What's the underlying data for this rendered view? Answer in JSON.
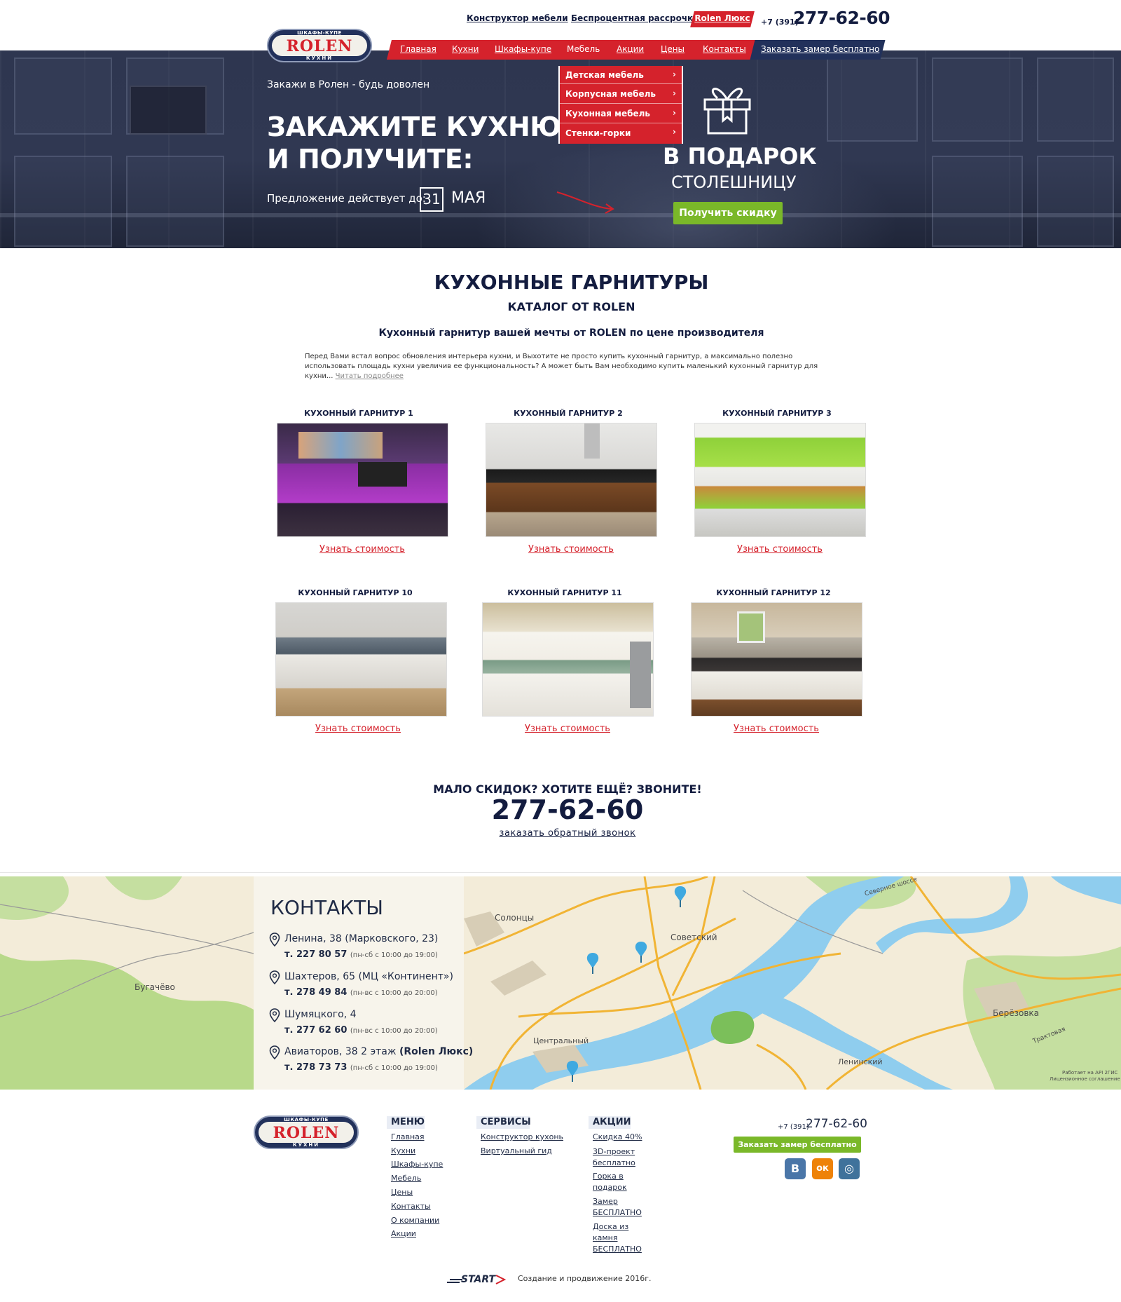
{
  "colors": {
    "brand_red": "#d5222c",
    "navy": "#131c3f",
    "green": "#7ab829"
  },
  "header": {
    "top_links": [
      "Конструктор мебели",
      "Беспроцентная рассрочка"
    ],
    "luxe_label": "Rolen Люкс",
    "phone_prefix": "+7 (391)",
    "phone": "277-62-60"
  },
  "logo": {
    "top_text": "ШКАФЫ-КУПЕ",
    "word": "ROLEN",
    "bottom_text": "КУХНИ"
  },
  "nav": {
    "items": [
      "Главная",
      "Кухни",
      "Шкафы-купе",
      "Мебель",
      "Акции",
      "Цены",
      "Контакты"
    ],
    "cta": "Заказать замер бесплатно",
    "dropdown": [
      "Детская мебель",
      "Корпусная мебель",
      "Кухонная мебель",
      "Стенки-горки"
    ]
  },
  "hero": {
    "tagline": "Закажи в Ролен - будь доволен",
    "headline_1": "ЗАКАЖИТЕ КУХНЮ",
    "headline_2": "И ПОЛУЧИТЕ:",
    "offer_label": "Предложение действует до:",
    "day": "31",
    "month": "МАЯ",
    "gift_title": "В ПОДАРОК",
    "gift_sub": "СТОЛЕШНИЦУ",
    "button": "Получить скидку"
  },
  "catalog": {
    "title": "КУХОННЫЕ ГАРНИТУРЫ",
    "subtitle": "КАТАЛОГ ОТ ROLEN",
    "tagline": "Кухонный гарнитур вашей мечты от ROLEN по цене производителя",
    "intro": "Перед Вами встал вопрос обновления интерьера кухни, и Выхотите не просто купить кухонный гарнитур, а максимально полезно использовать площадь кухни увеличив ее функциональность? А может быть Вам необходимо купить маленький кухонный гарнитур для кухни...",
    "read_more": "Читать подробнее",
    "cards": [
      {
        "title": "КУХОННЫЙ ГАРНИТУР 1",
        "link": "Узнать стоимость"
      },
      {
        "title": "КУХОННЫЙ ГАРНИТУР 2",
        "link": "Узнать стоимость"
      },
      {
        "title": "КУХОННЫЙ ГАРНИТУР 3",
        "link": "Узнать стоимость"
      },
      {
        "title": "КУХОННЫЙ ГАРНИТУР 10",
        "link": "Узнать стоимость"
      },
      {
        "title": "КУХОННЫЙ ГАРНИТУР 11",
        "link": "Узнать стоимость"
      },
      {
        "title": "КУХОННЫЙ ГАРНИТУР 12",
        "link": "Узнать стоимость"
      }
    ]
  },
  "cta": {
    "question": "МАЛО СКИДОК? ХОТИТЕ ЕЩЁ? ЗВОНИТЕ!",
    "phone": "277-62-60",
    "callback": "заказать обратный звонок"
  },
  "contacts": {
    "title": "КОНТАКТЫ",
    "items": [
      {
        "address": "Ленина, 38 (Марковского, 23)",
        "phone": "т. 227 80 57",
        "hours": "(пн-сб с 10:00 до 19:00)"
      },
      {
        "address": "Шахтеров, 65 (МЦ «Континент»)",
        "phone": "т. 278 49 84",
        "hours": "(пн-вс с 10:00 до 20:00)"
      },
      {
        "address": "Шумяцкого, 4",
        "phone": "т. 277 62 60",
        "hours": "(пн-вс с 10:00 до 20:00)"
      },
      {
        "address": "Авиаторов, 38 2 этаж",
        "address_bold": "(Rolen Люкс)",
        "phone": "т. 278 73 73",
        "hours": "(пн-сб с 10:00 до 19:00)"
      }
    ],
    "map_labels": [
      "Бугачёво",
      "Солонцы",
      "Советский",
      "Центральный",
      "Берёзовка",
      "Ленинский",
      "Северное шоссе",
      "Трактовая"
    ],
    "map_attribution": "Работает на API 2ГИС",
    "map_license": "Лицензионное соглашение"
  },
  "footer": {
    "menu_title": "МЕНЮ",
    "menu": [
      "Главная",
      "Кухни",
      "Шкафы-купе",
      "Мебель",
      "Цены",
      "Контакты",
      "О компании",
      "Акции"
    ],
    "services_title": "СЕРВИСЫ",
    "services": [
      "Конструктор кухонь",
      "Виртуальный гид"
    ],
    "promo_title": "АКЦИИ",
    "promo": [
      [
        "Скидка 40%"
      ],
      [
        "3D-проект",
        "бесплатно"
      ],
      [
        "Горка в",
        "подарок"
      ],
      [
        "Замер",
        "БЕСПЛАТНО"
      ],
      [
        "Доска из",
        "камня",
        "БЕСПЛАТНО"
      ]
    ],
    "phone_prefix": "+7 (391)",
    "phone": "277-62-60",
    "button": "Заказать замер бесплатно",
    "social": [
      {
        "icon": "vk-icon",
        "glyph": "В",
        "color": "#4a76a8"
      },
      {
        "icon": "odnoklassniki-icon",
        "glyph": "ок",
        "color": "#ee8208"
      },
      {
        "icon": "instagram-icon",
        "glyph": "◎",
        "color": "#3f729b"
      }
    ],
    "studio": "START",
    "made": "Создание и продвижение 2016г."
  }
}
